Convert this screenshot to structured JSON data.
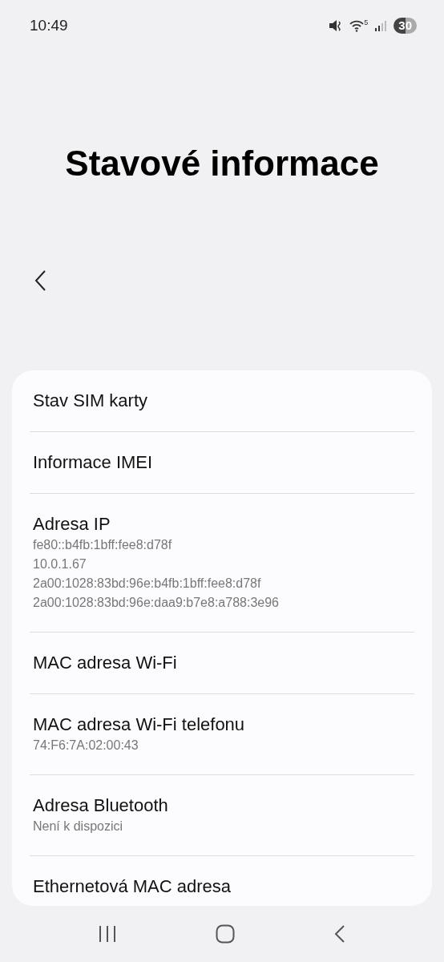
{
  "status_bar": {
    "time": "10:49",
    "battery": "30",
    "network_label": "5"
  },
  "title": "Stavové informace",
  "items": [
    {
      "label": "Stav SIM karty"
    },
    {
      "label": "Informace IMEI"
    },
    {
      "label": "Adresa IP",
      "values": [
        "fe80::b4fb:1bff:fee8:d78f",
        "10.0.1.67",
        "2a00:1028:83bd:96e:b4fb:1bff:fee8:d78f",
        "2a00:1028:83bd:96e:daa9:b7e8:a788:3e96"
      ]
    },
    {
      "label": "MAC adresa Wi-Fi"
    },
    {
      "label": "MAC adresa Wi-Fi telefonu",
      "values": [
        "74:F6:7A:02:00:43"
      ]
    },
    {
      "label": "Adresa Bluetooth",
      "values": [
        "Není k dispozici"
      ]
    },
    {
      "label": "Ethernetová MAC adresa"
    }
  ]
}
